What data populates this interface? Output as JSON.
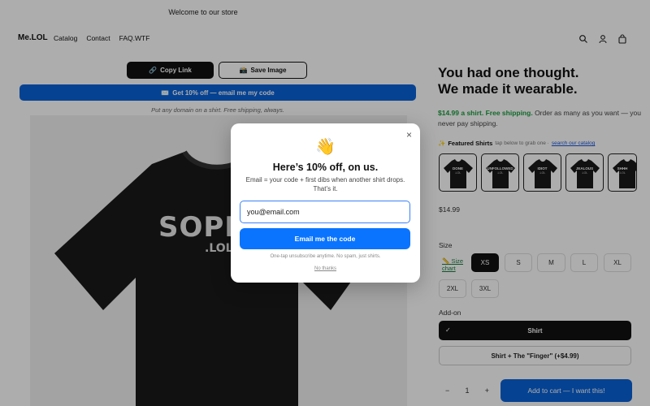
{
  "announcement": "Welcome to our store",
  "header": {
    "logo": "Me.LOL",
    "nav": [
      "Catalog",
      "Contact",
      "FAQ.WTF"
    ],
    "icons": [
      "search-icon",
      "account-icon",
      "cart-icon"
    ]
  },
  "actions": {
    "copy_link": "Copy Link",
    "save_image": "Save Image",
    "offer": "Get 10% off — email me my code",
    "tagline": "Put any domain on a shirt. Free shipping, always."
  },
  "product_image": {
    "shirt_text": "SOPI",
    "shirt_subtext": ".LOL"
  },
  "product": {
    "title_line1": "You had one thought.",
    "title_line2": "We made it wearable.",
    "desc_highlight": "$14.99 a shirt. Free shipping.",
    "desc_rest": "Order as many as you want — you never pay shipping.",
    "featured_label": "Featured Shirts",
    "featured_hint": "tap below to grab one ·",
    "featured_link": "search our catalog",
    "featured": [
      {
        "label": "DONE",
        "sub": ".LOL"
      },
      {
        "label": "UNFOLLOWED",
        "sub": ".LOL"
      },
      {
        "label": "IDIOT",
        "sub": ".LOL"
      },
      {
        "label": "JEALOUS",
        "sub": ".LOL"
      },
      {
        "label": "SHHH",
        "sub": ".LOL"
      }
    ],
    "price": "$14.99",
    "size_label": "Size",
    "size_chart": "Size chart",
    "sizes": [
      "XS",
      "S",
      "M",
      "L",
      "XL",
      "2XL",
      "3XL"
    ],
    "selected_size": "XS",
    "addon_label": "Add-on",
    "addon_options": [
      "Shirt",
      "Shirt + The \"Finger\" (+$4.99)"
    ],
    "addon_selected": "Shirt",
    "quantity": "1",
    "qty_minus": "−",
    "qty_plus": "+",
    "add_to_cart": "Add to cart — I want this!"
  },
  "modal": {
    "emoji": "👋",
    "title": "Here’s 10% off, on us.",
    "subtitle": "Email = your code + first dibs when another shirt drops. That’s it.",
    "input_value": "you@email.com",
    "button": "Email me the code",
    "fine_print": "One-tap unsubscribe anytime. No spam, just shirts.",
    "dismiss": "No thanks",
    "close": "×"
  },
  "colors": {
    "accent_blue": "#0a62d8",
    "modal_button": "#0a74ff",
    "green": "#1a9c3f"
  }
}
